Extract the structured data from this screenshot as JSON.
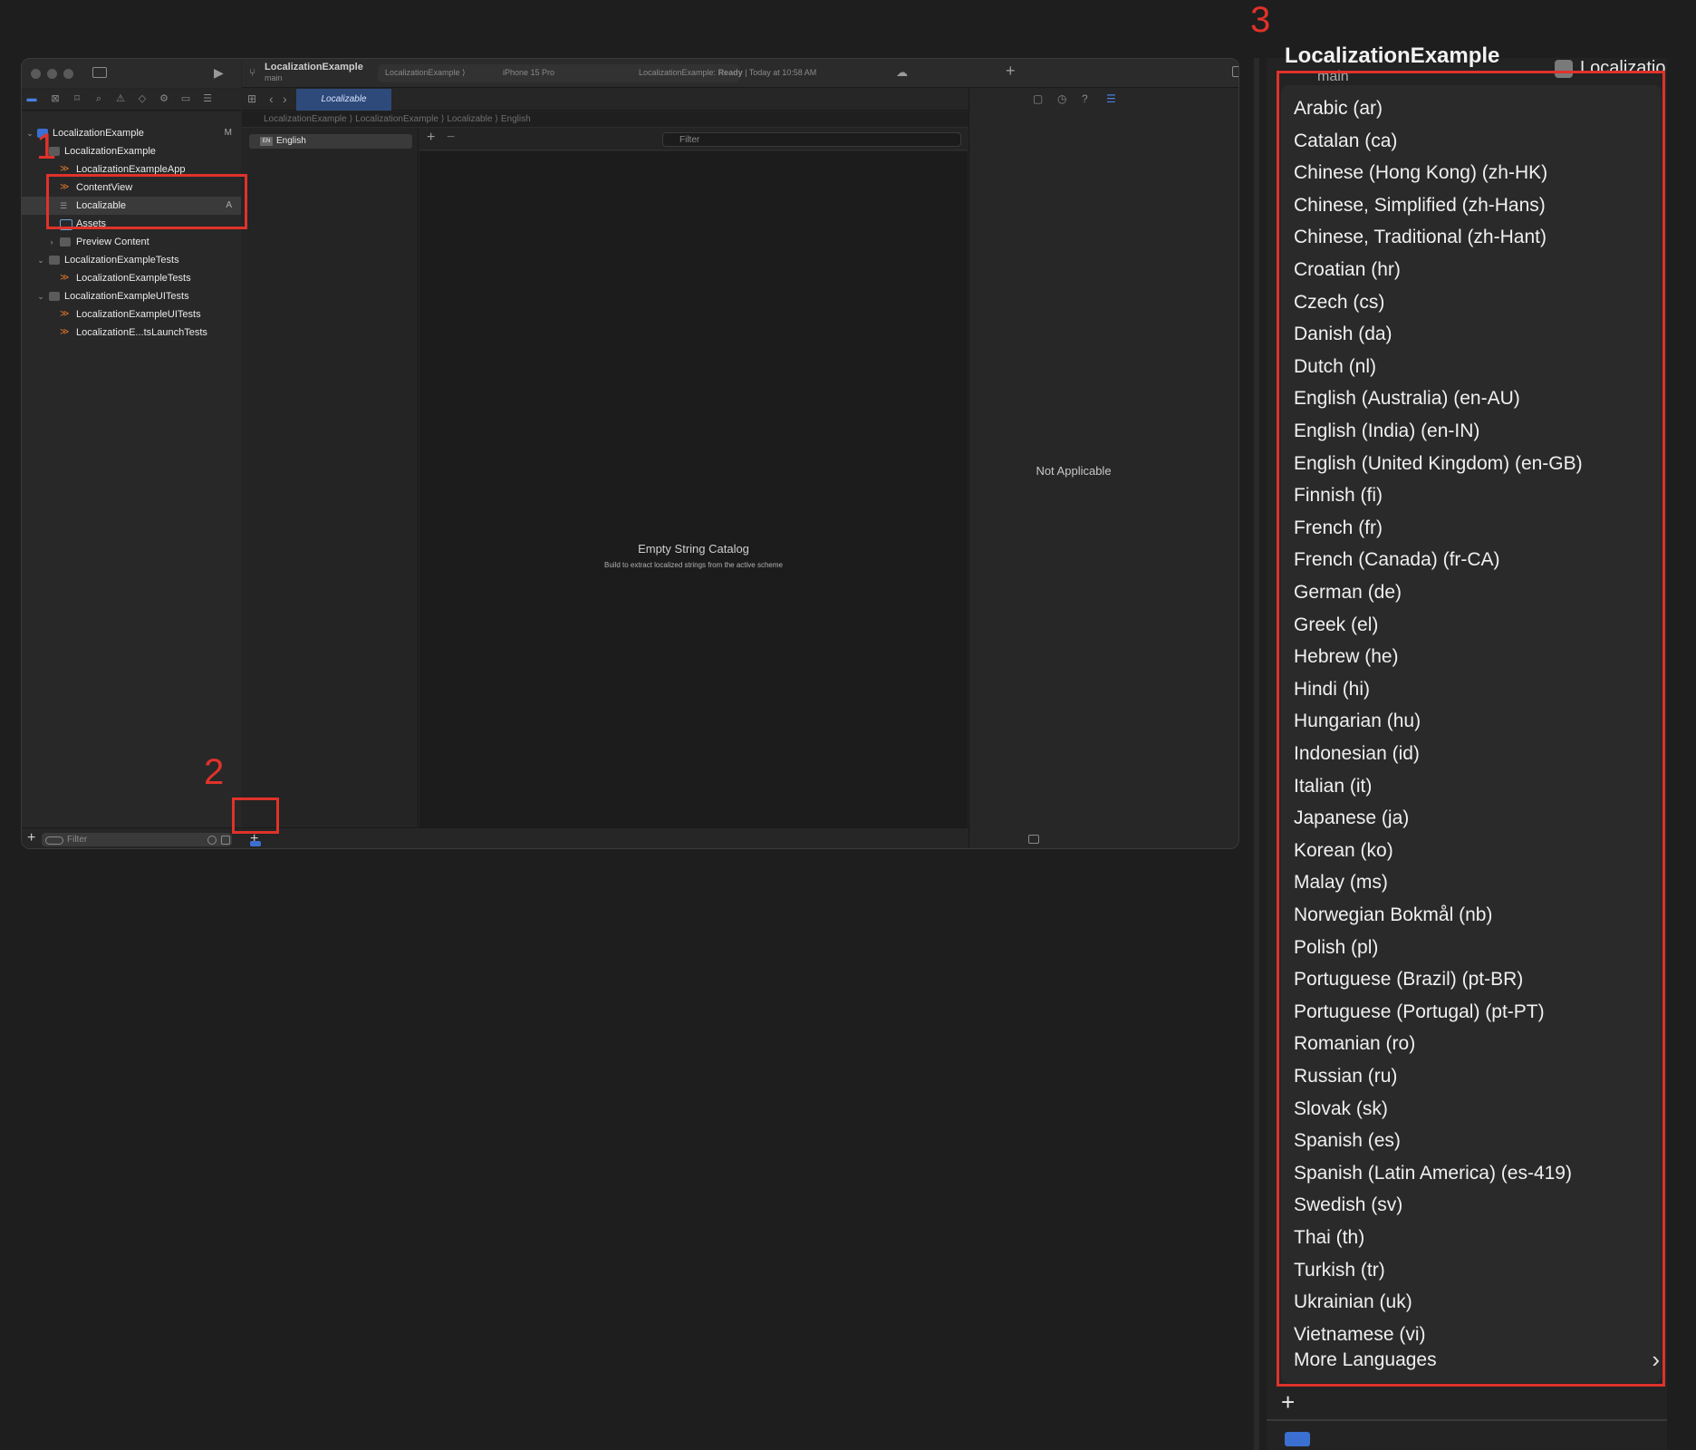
{
  "annotations": {
    "step1": "1",
    "step2": "2",
    "step3": "3"
  },
  "window": {
    "project_title": "LocalizationExample",
    "branch": "main",
    "scheme_target": "LocalizationExample ⟩",
    "device": "iPhone 15 Pro",
    "status_prefix": "LocalizationExample: ",
    "status_state": "Ready",
    "status_time": " | Today at 10:58 AM"
  },
  "navigator": {
    "items": [
      {
        "label": "LocalizationExample",
        "badge": "M"
      },
      {
        "label": "LocalizationExample"
      },
      {
        "label": "LocalizationExampleApp"
      },
      {
        "label": "ContentView"
      },
      {
        "label": "Localizable",
        "badge": "A"
      },
      {
        "label": "Assets"
      },
      {
        "label": "Preview Content"
      },
      {
        "label": "LocalizationExampleTests"
      },
      {
        "label": "LocalizationExampleTests"
      },
      {
        "label": "LocalizationExampleUITests"
      },
      {
        "label": "LocalizationExampleUITests"
      },
      {
        "label": "LocalizationE...tsLaunchTests"
      }
    ],
    "filter_placeholder": "Filter"
  },
  "editor": {
    "active_tab": "Localizable",
    "breadcrumb": "LocalizationExample ⟩ LocalizationExample ⟩ Localizable ⟩ English",
    "language": "English",
    "language_code": "EN",
    "filter_placeholder": "Filter",
    "empty_title": "Empty String Catalog",
    "empty_subtitle": "Build to extract localized strings from the active scheme"
  },
  "inspector": {
    "text": "Not Applicable"
  },
  "zoomed": {
    "header_title": "LocalizationExample",
    "header_branch": "main",
    "header_tab": "Localizatio",
    "languages": [
      "Arabic (ar)",
      "Catalan (ca)",
      "Chinese (Hong Kong) (zh-HK)",
      "Chinese, Simplified (zh-Hans)",
      "Chinese, Traditional (zh-Hant)",
      "Croatian (hr)",
      "Czech (cs)",
      "Danish (da)",
      "Dutch (nl)",
      "English (Australia) (en-AU)",
      "English (India) (en-IN)",
      "English (United Kingdom) (en-GB)",
      "Finnish (fi)",
      "French (fr)",
      "French (Canada) (fr-CA)",
      "German (de)",
      "Greek (el)",
      "Hebrew (he)",
      "Hindi (hi)",
      "Hungarian (hu)",
      "Indonesian (id)",
      "Italian (it)",
      "Japanese (ja)",
      "Korean (ko)",
      "Malay (ms)",
      "Norwegian Bokmål (nb)",
      "Polish (pl)",
      "Portuguese (Brazil) (pt-BR)",
      "Portuguese (Portugal) (pt-PT)",
      "Romanian (ro)",
      "Russian (ru)",
      "Slovak (sk)",
      "Spanish (es)",
      "Spanish (Latin America) (es-419)",
      "Swedish (sv)",
      "Thai (th)",
      "Turkish (tr)",
      "Ukrainian (uk)",
      "Vietnamese (vi)"
    ],
    "more_languages": "More Languages"
  },
  "colors": {
    "annotation_red": "#e0322a",
    "accent_blue": "#3b6fd1"
  }
}
